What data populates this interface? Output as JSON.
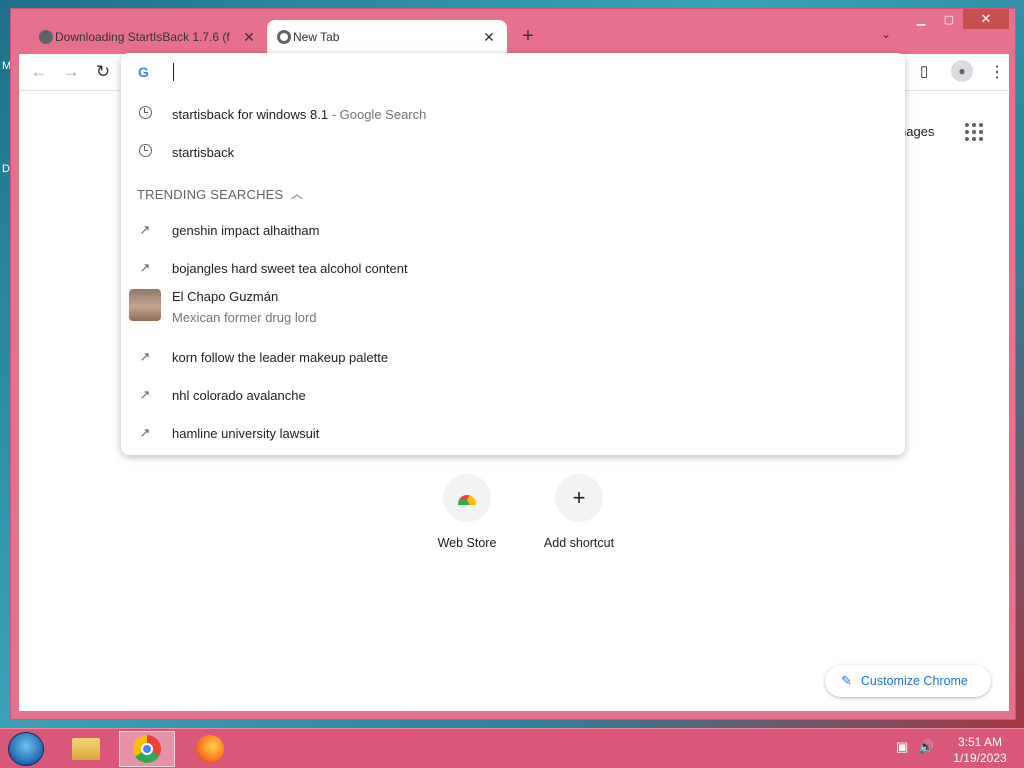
{
  "desktop": {
    "edge_letters": [
      "M",
      "D"
    ]
  },
  "tabs": [
    {
      "title": "Downloading StartIsBack 1.7.6 (f",
      "active": false
    },
    {
      "title": "New Tab",
      "active": true
    }
  ],
  "toolbar": {
    "back": "←",
    "forward": "→",
    "reload": "↻",
    "sidepanel": "▯",
    "menu": "⋮"
  },
  "omnibox": {
    "logo": "G",
    "history": [
      {
        "query": "startisback for windows 8.1",
        "suffix": " - Google Search"
      },
      {
        "query": "startisback",
        "suffix": ""
      }
    ],
    "trending_header": "TRENDING SEARCHES",
    "trending": [
      {
        "title": "genshin impact alhaitham"
      },
      {
        "title": "bojangles hard sweet tea alcohol content"
      },
      {
        "title": "El Chapo Guzmán",
        "subtitle": "Mexican former drug lord"
      },
      {
        "title": "korn follow the leader makeup palette"
      },
      {
        "title": "nhl colorado avalanche"
      },
      {
        "title": "hamline university lawsuit"
      }
    ]
  },
  "page": {
    "images_link": "nages",
    "shortcuts": [
      {
        "label": "Web Store",
        "icon": "webstore-icon"
      },
      {
        "label": "Add shortcut",
        "icon": "plus-icon"
      }
    ],
    "customize": "Customize Chrome"
  },
  "taskbar": {
    "time": "3:51 AM",
    "date": "1/19/2023",
    "accent": "#d9587a"
  }
}
